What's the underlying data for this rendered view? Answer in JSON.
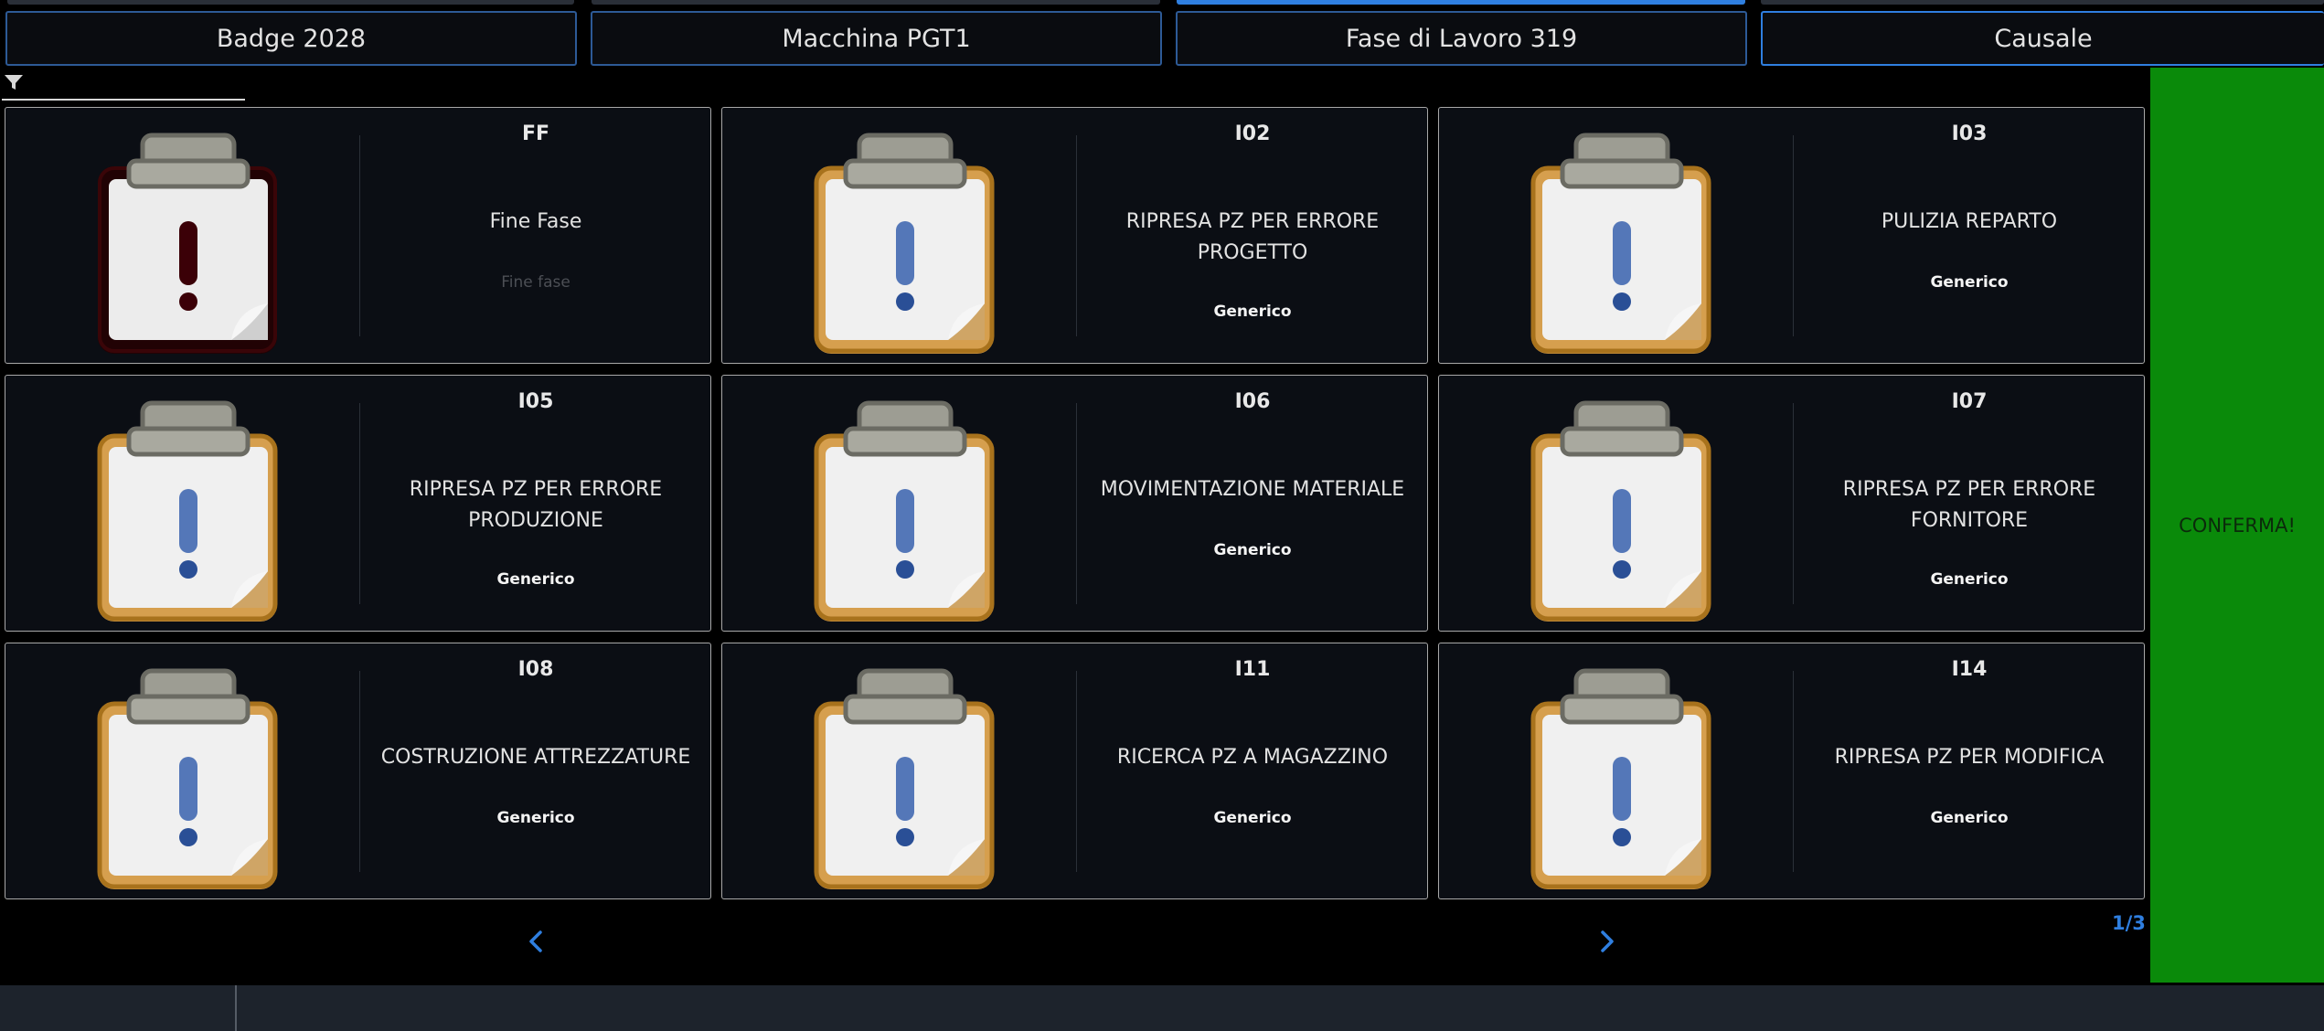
{
  "tabs": [
    {
      "label": "Badge 2028"
    },
    {
      "label": "Macchina PGT1"
    },
    {
      "label": "Fase di Lavoro 319"
    },
    {
      "label": "Causale"
    }
  ],
  "cards": [
    {
      "code": "FF",
      "desc1": "Fine Fase",
      "desc2": "",
      "type": "Fine fase",
      "icon": "clipboard-alert-dark-icon"
    },
    {
      "code": "I02",
      "desc1": "RIPRESA PZ PER ERRORE",
      "desc2": "PROGETTO",
      "type": "Generico",
      "icon": "clipboard-alert-icon"
    },
    {
      "code": "I03",
      "desc1": "PULIZIA REPARTO",
      "desc2": "",
      "type": "Generico",
      "icon": "clipboard-alert-icon"
    },
    {
      "code": "I05",
      "desc1": "RIPRESA PZ PER ERRORE",
      "desc2": "PRODUZIONE",
      "type": "Generico",
      "icon": "clipboard-alert-icon"
    },
    {
      "code": "I06",
      "desc1": "MOVIMENTAZIONE MATERIALE",
      "desc2": "",
      "type": "Generico",
      "icon": "clipboard-alert-icon"
    },
    {
      "code": "I07",
      "desc1": "RIPRESA PZ PER ERRORE",
      "desc2": "FORNITORE",
      "type": "Generico",
      "icon": "clipboard-alert-icon"
    },
    {
      "code": "I08",
      "desc1": "COSTRUZIONE ATTREZZATURE",
      "desc2": "",
      "type": "Generico",
      "icon": "clipboard-alert-icon"
    },
    {
      "code": "I11",
      "desc1": "RICERCA PZ A MAGAZZINO",
      "desc2": "",
      "type": "Generico",
      "icon": "clipboard-alert-icon"
    },
    {
      "code": "I14",
      "desc1": "RIPRESA PZ PER MODIFICA",
      "desc2": "",
      "type": "Generico",
      "icon": "clipboard-alert-icon"
    }
  ],
  "confirm_label": "CONFERMA!",
  "pagination": {
    "label": "1/3"
  },
  "colors": {
    "accent": "#2f7fe0",
    "confirm_bg": "#0a8a0a",
    "card_border": "#a8a8a8",
    "card_bg": "#0b0e14"
  },
  "icons": {
    "filter": "filter-icon",
    "prev": "chevron-left-icon",
    "next": "chevron-right-icon"
  }
}
